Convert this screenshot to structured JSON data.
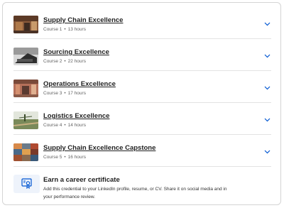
{
  "courses": [
    {
      "title": "Supply Chain Excellence",
      "course_no": "Course 1",
      "duration": "13 hours",
      "thumb": "warehouse-thumbnail"
    },
    {
      "title": "Sourcing Excellence",
      "course_no": "Course 2",
      "duration": "22 hours",
      "thumb": "sourcing-thumbnail"
    },
    {
      "title": "Operations Excellence",
      "course_no": "Course 3",
      "duration": "17 hours",
      "thumb": "operations-thumbnail"
    },
    {
      "title": "Logistics Excellence",
      "course_no": "Course 4",
      "duration": "14 hours",
      "thumb": "logistics-thumbnail"
    },
    {
      "title": "Supply Chain Excellence Capstone",
      "course_no": "Course 5",
      "duration": "16 hours",
      "thumb": "capstone-thumbnail"
    }
  ],
  "separator": "•",
  "certificate": {
    "title": "Earn a career certificate",
    "description": "Add this credential to your LinkedIn profile, resume, or CV. Share it on social media and in your performance review.",
    "icon": "certificate-icon"
  },
  "colors": {
    "chevron": "#0056d2",
    "title": "#1f1f1f",
    "meta": "#636363",
    "icon_bg": "#eef3fb"
  }
}
